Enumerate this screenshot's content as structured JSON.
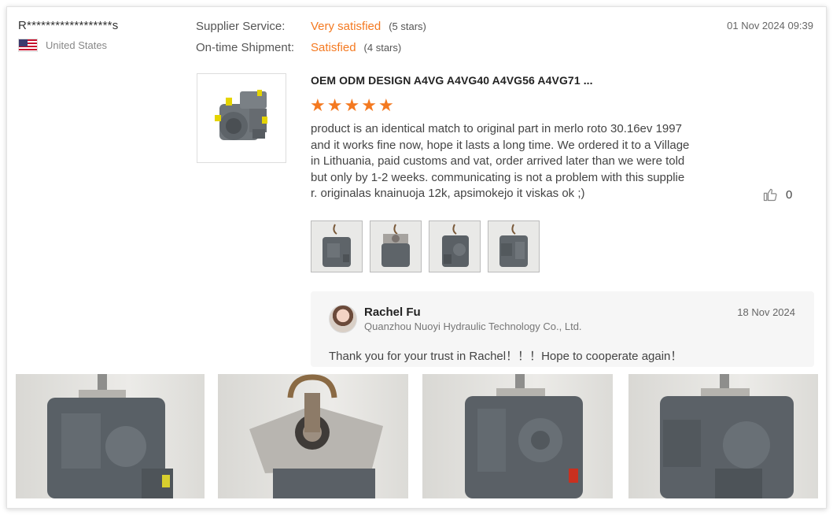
{
  "reviewer": {
    "name": "R******************s",
    "country": "United States",
    "flag_icon": "us-flag-icon"
  },
  "ratings": [
    {
      "label": "Supplier Service:",
      "value": "Very satisfied",
      "stars": "(5 stars)"
    },
    {
      "label": "On-time Shipment:",
      "value": "Satisfied",
      "stars": "(4 stars)"
    }
  ],
  "review_date": "01 Nov 2024 09:39",
  "product": {
    "title": "OEM ODM DESIGN A4VG A4VG40 A4VG56 A4VG71 ...",
    "rating": 5,
    "thumbnail": "hydraulic-pump-image"
  },
  "review": {
    "text": "product is an identical match to original part in merlo roto 30.16ev 1997\nand it works fine now, hope it lasts a long time. We ordered it to a Village\nin Lithuania, paid customs and vat, order arrived later than we were told\nbut only by 1-2 weeks. communicating is not a problem with this supplie\nr. originalas knainuoja 12k, apsimokejo it viskas ok ;)"
  },
  "helpful": {
    "icon": "thumbs-up-icon",
    "count": "0"
  },
  "review_images": [
    "pump-photo-1",
    "pump-photo-2",
    "pump-photo-3",
    "pump-photo-4"
  ],
  "reply": {
    "name": "Rachel Fu",
    "company": "Quanzhou Nuoyi Hydraulic Technology Co., Ltd.",
    "date": "18 Nov 2024",
    "text": "Thank you for your trust in Rachel！！！Hope to cooperate again！"
  },
  "colors": {
    "accent": "#f47920",
    "text": "#333333",
    "muted": "#888888",
    "reply_bg": "#f6f6f6"
  }
}
